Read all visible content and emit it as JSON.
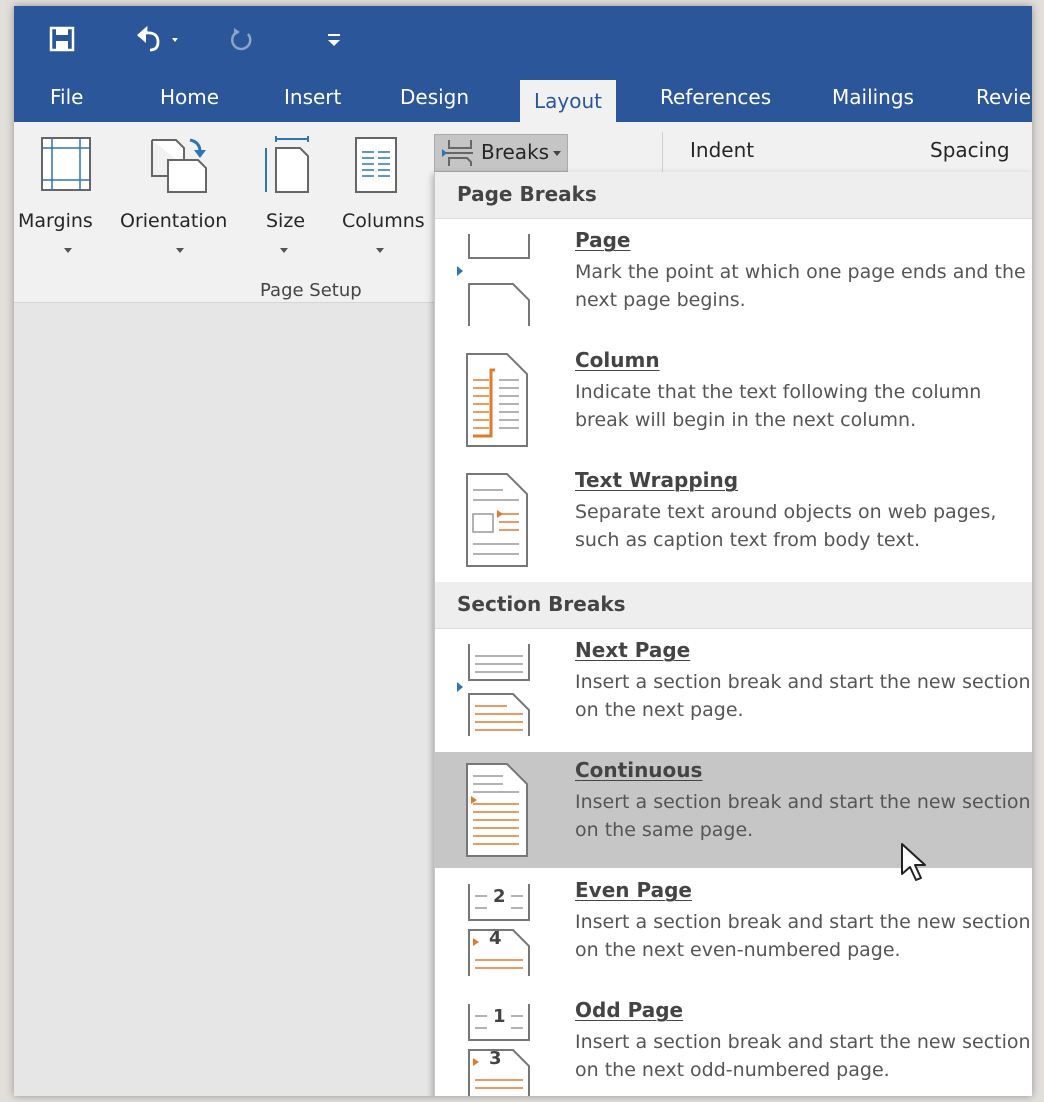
{
  "tabs": [
    "File",
    "Home",
    "Insert",
    "Design",
    "Layout",
    "References",
    "Mailings",
    "Revie"
  ],
  "active_tab": "Layout",
  "ribbon": {
    "buttons": [
      {
        "label": "Margins"
      },
      {
        "label": "Orientation"
      },
      {
        "label": "Size"
      },
      {
        "label": "Columns"
      }
    ],
    "group_label": "Page Setup",
    "breaks_label": "Breaks",
    "indent_label": "Indent",
    "spacing_label": "Spacing"
  },
  "menu": {
    "headers": [
      "Page Breaks",
      "Section Breaks"
    ],
    "items": [
      {
        "title": "Page",
        "accel": "P",
        "desc": "Mark the point at which one page ends and the next page begins.",
        "icon": "page-break-icon"
      },
      {
        "title": "Column",
        "accel": "C",
        "desc": "Indicate that the text following the column break will begin in the next column.",
        "icon": "column-break-icon"
      },
      {
        "title": "Text Wrapping",
        "accel": "T",
        "desc": "Separate text around objects on web pages, such as caption text from body text.",
        "icon": "text-wrapping-icon"
      },
      {
        "title": "Next Page",
        "accel": "N",
        "desc": "Insert a section break and start the new section on the next page.",
        "icon": "next-page-icon"
      },
      {
        "title": "Continuous",
        "accel": "o",
        "desc": "Insert a section break and start the new section on the same page.",
        "icon": "continuous-icon",
        "highlighted": true
      },
      {
        "title": "Even Page",
        "accel": "E",
        "desc": "Insert a section break and start the new section on the next even-numbered page.",
        "icon": "even-page-icon"
      },
      {
        "title": "Odd Page",
        "accel": "d",
        "desc": "Insert a section break and start the new section on the next odd-numbered page.",
        "icon": "odd-page-icon"
      }
    ],
    "icon_numbers": {
      "even_top": "2",
      "even_bottom": "4",
      "odd_top": "1",
      "odd_bottom": "3"
    }
  },
  "colors": {
    "titlebar": "#2b579a",
    "accent_orange": "#e07a2e",
    "marker_blue": "#2e75b6",
    "highlight": "#c6c6c6"
  }
}
